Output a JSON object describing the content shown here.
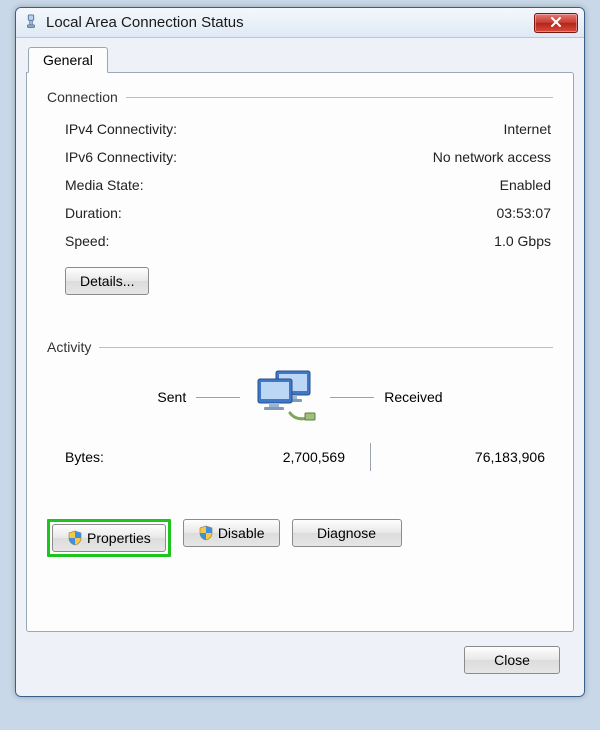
{
  "window": {
    "title": "Local Area Connection Status"
  },
  "tab": {
    "general": "General"
  },
  "connection": {
    "header": "Connection",
    "ipv4_label": "IPv4 Connectivity:",
    "ipv4_value": "Internet",
    "ipv6_label": "IPv6 Connectivity:",
    "ipv6_value": "No network access",
    "media_label": "Media State:",
    "media_value": "Enabled",
    "duration_label": "Duration:",
    "duration_value": "03:53:07",
    "speed_label": "Speed:",
    "speed_value": "1.0 Gbps",
    "details_button": "Details..."
  },
  "activity": {
    "header": "Activity",
    "sent_label": "Sent",
    "received_label": "Received",
    "bytes_label": "Bytes:",
    "sent_bytes": "2,700,569",
    "received_bytes": "76,183,906"
  },
  "buttons": {
    "properties": "Properties",
    "disable": "Disable",
    "diagnose": "Diagnose",
    "close": "Close"
  }
}
